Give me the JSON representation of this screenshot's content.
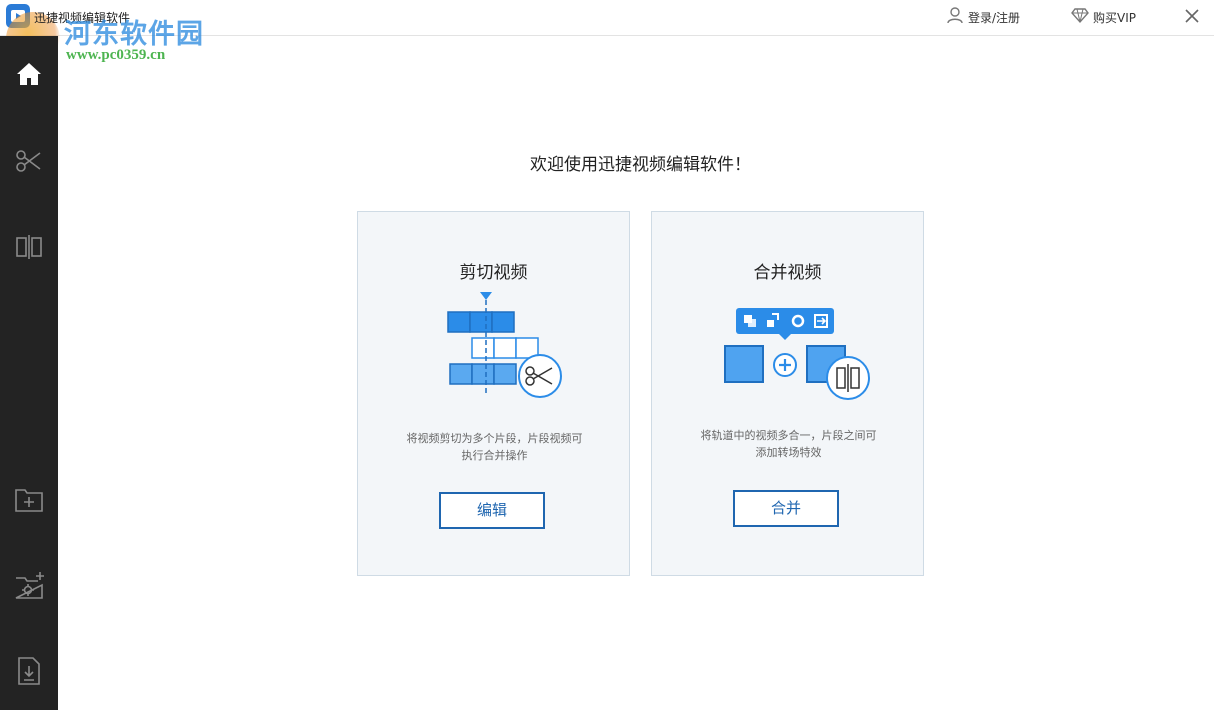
{
  "window": {
    "title": "迅捷视频编辑软件",
    "watermark_title": "河东软件园",
    "watermark_url": "www.pc0359.cn"
  },
  "header": {
    "login_label": "登录/注册",
    "vip_label": "购买VIP",
    "icons": [
      "user-icon",
      "diamond-icon",
      "close-icon"
    ]
  },
  "sidebar": {
    "items": [
      {
        "name": "home",
        "icon": "home-icon",
        "active": true
      },
      {
        "name": "cut",
        "icon": "scissors-icon",
        "active": false
      },
      {
        "name": "merge",
        "icon": "split-merge-icon",
        "active": false
      },
      {
        "name": "add-file",
        "icon": "folder-plus-icon",
        "active": false
      },
      {
        "name": "settings-folder",
        "icon": "folder-gear-icon",
        "active": false
      },
      {
        "name": "export",
        "icon": "file-download-icon",
        "active": false
      }
    ]
  },
  "main": {
    "welcome": "欢迎使用迅捷视频编辑软件！",
    "cards": [
      {
        "title": "剪切视频",
        "desc_line1": "将视频剪切为多个片段，片段视频可",
        "desc_line2": "执行合并操作",
        "button": "编辑",
        "icon": "cut-video-illustration"
      },
      {
        "title": "合并视频",
        "desc_line1": "将轨道中的视频多合一，片段之间可",
        "desc_line2": "添加转场特效",
        "button": "合并",
        "icon": "merge-video-illustration"
      }
    ]
  },
  "colors": {
    "accent": "#1f66b0",
    "illustration_blue": "#2b8ce8",
    "sidebar_bg": "#232323",
    "card_bg": "#f3f6f9"
  }
}
